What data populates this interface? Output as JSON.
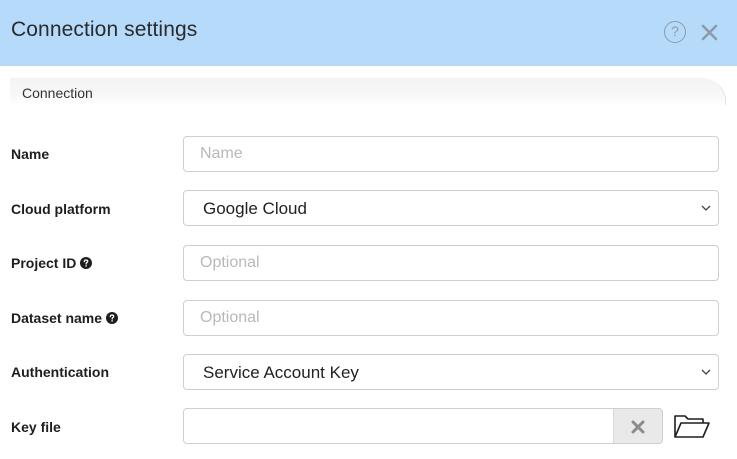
{
  "header": {
    "title": "Connection settings",
    "help_glyph": "?"
  },
  "section_tab": {
    "label": "Connection"
  },
  "form": {
    "name": {
      "label": "Name",
      "placeholder": "Name",
      "value": ""
    },
    "cloud_platform": {
      "label": "Cloud platform",
      "selected": "Google Cloud"
    },
    "project_id": {
      "label": "Project ID",
      "placeholder": "Optional",
      "value": ""
    },
    "dataset_name": {
      "label": "Dataset name",
      "placeholder": "Optional",
      "value": ""
    },
    "authentication": {
      "label": "Authentication",
      "selected": "Service Account Key"
    },
    "key_file": {
      "label": "Key file",
      "value": ""
    }
  },
  "icons": {
    "help": "question-circle-icon",
    "close": "close-icon",
    "info": "question-circle-solid-icon",
    "chevron": "chevron-down-icon",
    "clear": "x-icon",
    "folder": "folder-open-icon"
  },
  "colors": {
    "header_bg": "#b6dbfa",
    "header_icon": "#8e9aa6",
    "field_border": "#cfcfcf",
    "placeholder": "#b8b8b8"
  }
}
